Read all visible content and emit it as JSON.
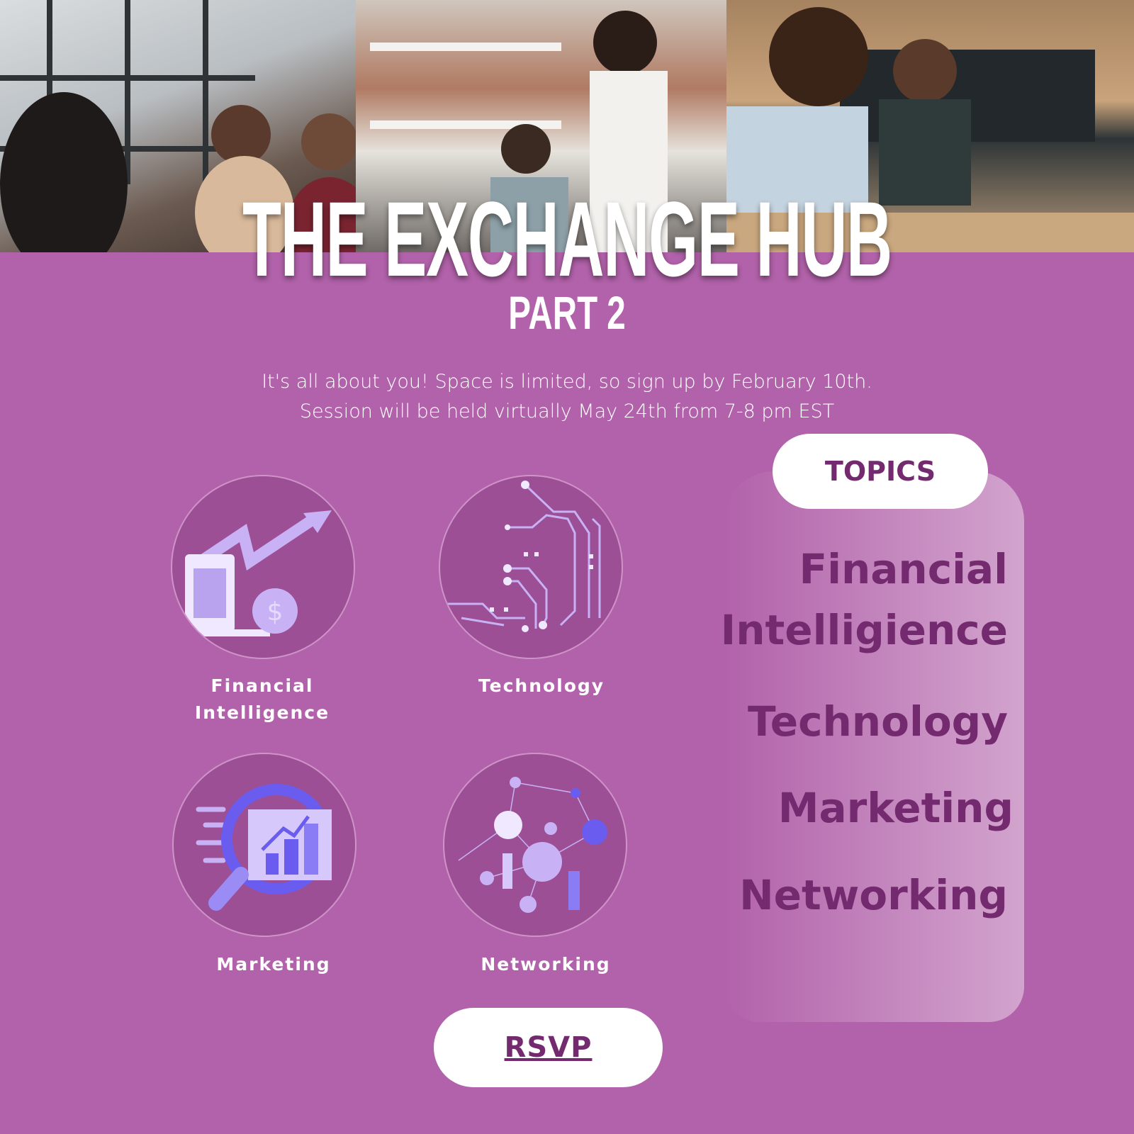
{
  "header": {
    "title": "THE EXCHANGE HUB",
    "subtitle": "PART 2"
  },
  "description": {
    "line1": "It's all about you! Space is limited, so sign up by February 10th.",
    "line2": "Session will be held virtually May 24th from 7-8 pm EST"
  },
  "icons": [
    {
      "label_line1": "Financial",
      "label_line2": "Intelligence",
      "icon": "finance-growth-icon"
    },
    {
      "label_line1": "Technology",
      "icon": "circuit-icon"
    },
    {
      "label_line1": "Marketing",
      "icon": "magnifier-chart-icon"
    },
    {
      "label_line1": "Networking",
      "icon": "network-people-icon"
    }
  ],
  "topics": {
    "heading": "TOPICS",
    "items": [
      "Financial",
      "Intelligience",
      "Technology",
      "Marketing",
      "Networking"
    ]
  },
  "rsvp": {
    "label": "RSVP"
  },
  "colors": {
    "background": "#b262aa",
    "circle": "#9c4f95",
    "accent_text": "#742a6e",
    "illustration": "#c8b2f5"
  }
}
